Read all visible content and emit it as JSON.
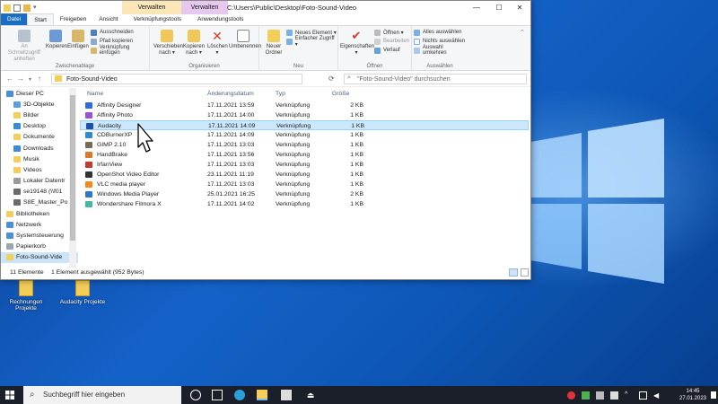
{
  "window": {
    "title": "C:\\Users\\Public\\Desktop\\Foto-Sound-Video",
    "context_tabs": [
      "Verwalten",
      "Verwalten"
    ],
    "controls": {
      "minimize": "—",
      "maximize": "☐",
      "close": "✕"
    }
  },
  "menu_tabs": [
    "Datei",
    "Start",
    "Freigeben",
    "Ansicht",
    "Verknüpfungstools",
    "Anwendungstools"
  ],
  "ribbon": {
    "clipboard": {
      "label": "Zwischenablage",
      "pin": "An Schnellzugriff anheften",
      "copy": "Kopieren",
      "paste": "Einfügen",
      "cut": "Ausschneiden",
      "copy_path": "Pfad kopieren",
      "paste_shortcut": "Verknüpfung einfügen"
    },
    "organize": {
      "label": "Organisieren",
      "move": "Verschieben nach ▾",
      "copy_to": "Kopieren nach ▾",
      "delete": "Löschen ▾",
      "rename": "Umbenennen"
    },
    "new": {
      "label": "Neu",
      "new_folder": "Neuer Ordner",
      "new_item": "Neues Element ▾",
      "easy_access": "Einfacher Zugriff ▾"
    },
    "open": {
      "label": "Öffnen",
      "properties": "Eigenschaften ▾",
      "open": "Öffnen ▾",
      "edit": "Bearbeiten",
      "history": "Verlauf"
    },
    "select": {
      "label": "Auswählen",
      "select_all": "Alles auswählen",
      "select_none": "Nichts auswählen",
      "invert": "Auswahl umkehren"
    }
  },
  "address": {
    "path": "Foto-Sound-Video",
    "search_placeholder": "\"Foto-Sound-Video\" durchsuchen"
  },
  "nav_pane": [
    {
      "label": "Dieser PC",
      "color": "#4a90d9"
    },
    {
      "label": "3D-Objekte",
      "color": "#5aa0e0"
    },
    {
      "label": "Bilder",
      "color": "#f3cf5a"
    },
    {
      "label": "Desktop",
      "color": "#3b8ad8"
    },
    {
      "label": "Dokumente",
      "color": "#f3cf5a"
    },
    {
      "label": "Downloads",
      "color": "#3b8ad8"
    },
    {
      "label": "Musik",
      "color": "#f3cf5a"
    },
    {
      "label": "Videos",
      "color": "#f3cf5a"
    },
    {
      "label": "Lokaler Datentr",
      "color": "#9a9a9a"
    },
    {
      "label": "se19148 (\\\\f01",
      "color": "#6a6a6a"
    },
    {
      "label": "S8E_Master_Po",
      "color": "#6a6a6a"
    },
    {
      "label": "Bibliotheken",
      "color": "#f3cf5a"
    },
    {
      "label": "Netzwerk",
      "color": "#4a90d9"
    },
    {
      "label": "Systemsteuerung",
      "color": "#4a90d9"
    },
    {
      "label": "Papierkorb",
      "color": "#9aa7b5"
    },
    {
      "label": "Foto-Sound-Vide",
      "color": "#f3cf5a"
    }
  ],
  "columns": {
    "name": "Name",
    "date": "Änderungsdatum",
    "type": "Typ",
    "size": "Größe"
  },
  "files": [
    {
      "name": "Affinity Designer",
      "date": "17.11.2021 13:59",
      "type": "Verknüpfung",
      "size": "2 KB",
      "color": "#2b6fd6"
    },
    {
      "name": "Affinity Photo",
      "date": "17.11.2021 14:00",
      "type": "Verknüpfung",
      "size": "1 KB",
      "color": "#9d4fd8"
    },
    {
      "name": "Audacity",
      "date": "17.11.2021 14:09",
      "type": "Verknüpfung",
      "size": "1 KB",
      "color": "#1d4fa8"
    },
    {
      "name": "CDBurnerXP",
      "date": "17.11.2021 14:09",
      "type": "Verknüpfung",
      "size": "1 KB",
      "color": "#2f8bd1"
    },
    {
      "name": "GIMP 2.10",
      "date": "17.11.2021 13:03",
      "type": "Verknüpfung",
      "size": "1 KB",
      "color": "#7a6a55"
    },
    {
      "name": "HandBrake",
      "date": "17.11.2021 13:56",
      "type": "Verknüpfung",
      "size": "1 KB",
      "color": "#d9792a"
    },
    {
      "name": "IrfanView",
      "date": "17.11.2021 13:03",
      "type": "Verknüpfung",
      "size": "1 KB",
      "color": "#c43a2a"
    },
    {
      "name": "OpenShot Video Editor",
      "date": "23.11.2021 11:19",
      "type": "Verknüpfung",
      "size": "1 KB",
      "color": "#333333"
    },
    {
      "name": "VLC media player",
      "date": "17.11.2021 13:03",
      "type": "Verknüpfung",
      "size": "1 KB",
      "color": "#f28b1c"
    },
    {
      "name": "Windows Media Player",
      "date": "25.01.2021 16:25",
      "type": "Verknüpfung",
      "size": "2 KB",
      "color": "#2a79c9"
    },
    {
      "name": "Wondershare Filmora X",
      "date": "17.11.2021 14:02",
      "type": "Verknüpfung",
      "size": "1 KB",
      "color": "#3fb8a8"
    }
  ],
  "selected_index": 2,
  "status": {
    "count": "11 Elemente",
    "selection": "1 Element ausgewählt (952 Bytes)"
  },
  "desktop_icons": [
    {
      "label": "Rechnungen Projekte"
    },
    {
      "label": "Audacity Projekte"
    }
  ],
  "taskbar": {
    "search_placeholder": "Suchbegriff hier eingeben",
    "time": "14:45",
    "date": "27.01.2023"
  }
}
